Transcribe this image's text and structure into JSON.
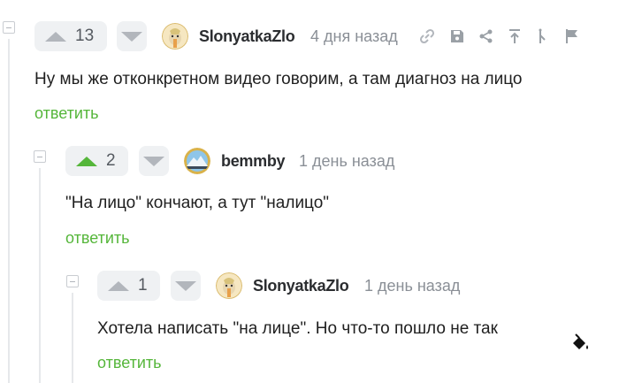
{
  "comments": [
    {
      "rating": "13",
      "username": "SlonyatkaZlo",
      "time": "4 дня назад",
      "text": "Ну мы же отконкретном видео говорим, а там диагноз на лицо",
      "reply": "ответить"
    },
    {
      "rating": "2",
      "username": "bemmby",
      "time": "1 день назад",
      "text": "\"На лицо\" кончают, а тут \"налицо\"",
      "reply": "ответить"
    },
    {
      "rating": "1",
      "username": "SlonyatkaZlo",
      "time": "1 день назад",
      "text": "Хотела написать \"на лице\". Но что-то пошло не так",
      "reply": "ответить"
    }
  ],
  "colors": {
    "accent_green": "#55b63a",
    "muted_gray": "#8a8f96",
    "button_bg": "#eff1f3"
  },
  "toolbar_icons": [
    "link-icon",
    "save-icon",
    "share-icon",
    "branch-up-icon",
    "branch-icon",
    "flag-icon"
  ],
  "floating_icon": "paint-bucket-icon"
}
